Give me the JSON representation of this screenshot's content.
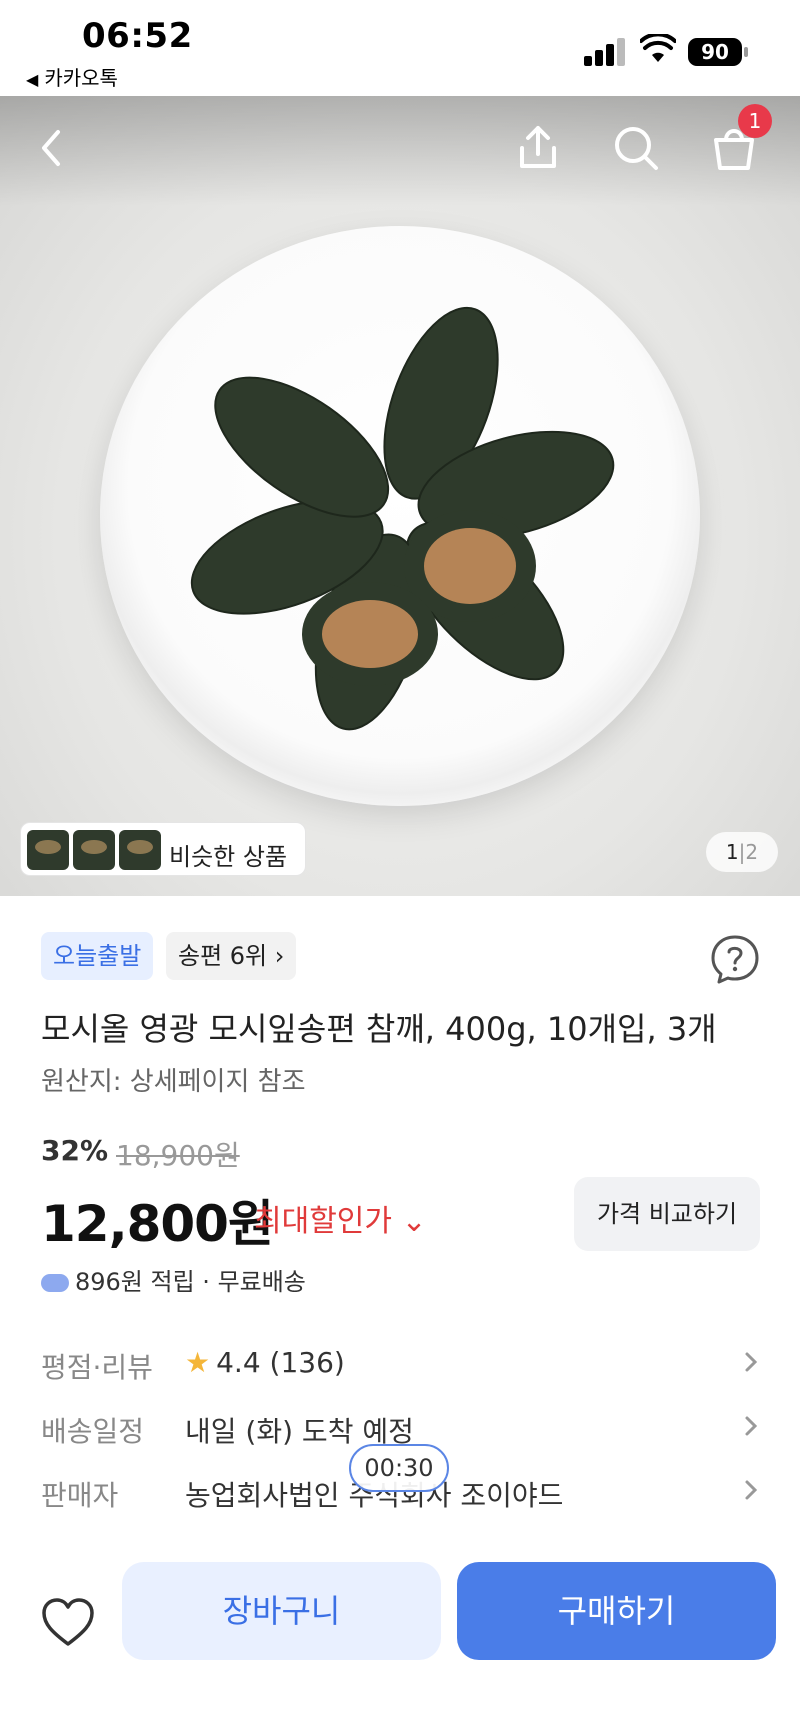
{
  "status_bar": {
    "time": "06:52",
    "back_app": "카카오톡",
    "battery": "90"
  },
  "hero": {
    "nav": {
      "back_icon": "chevron-left-icon",
      "share_icon": "share-icon",
      "search_icon": "search-icon",
      "cart_icon": "shopping-bag-icon",
      "cart_count": "1"
    },
    "similar_products_label": "비슷한 상품",
    "page_current": "1",
    "page_sep": "|",
    "page_total": "2"
  },
  "badges": {
    "today_ship": "오늘출발",
    "rank": "송편 6위 ›"
  },
  "product": {
    "title": "모시올 영광 모시잎송편 참깨, 400g, 10개입, 3개",
    "origin": "원산지: 상세페이지 참조",
    "discount_rate": "32%",
    "original_price": "18,900원",
    "price": "12,800원",
    "max_discount_label": "최대할인가 ⌄",
    "compare_label": "가격 비교하기",
    "points_text": "896원 적립 · 무료배송"
  },
  "info_rows": [
    {
      "label": "평점·리뷰",
      "value": "4.4 (136)",
      "star": "★"
    },
    {
      "label": "배송일정",
      "value": "내일 (화) 도착 예정"
    },
    {
      "label": "판매자",
      "value": "농업회사법인 주식회사 조이야드"
    }
  ],
  "timer": "00:30",
  "bottom_bar": {
    "cart_label": "장바구니",
    "buy_label": "구매하기"
  },
  "colors": {
    "accent": "#4a7de8",
    "badge_red": "#e8394a",
    "discount_red": "#e03a3a"
  }
}
